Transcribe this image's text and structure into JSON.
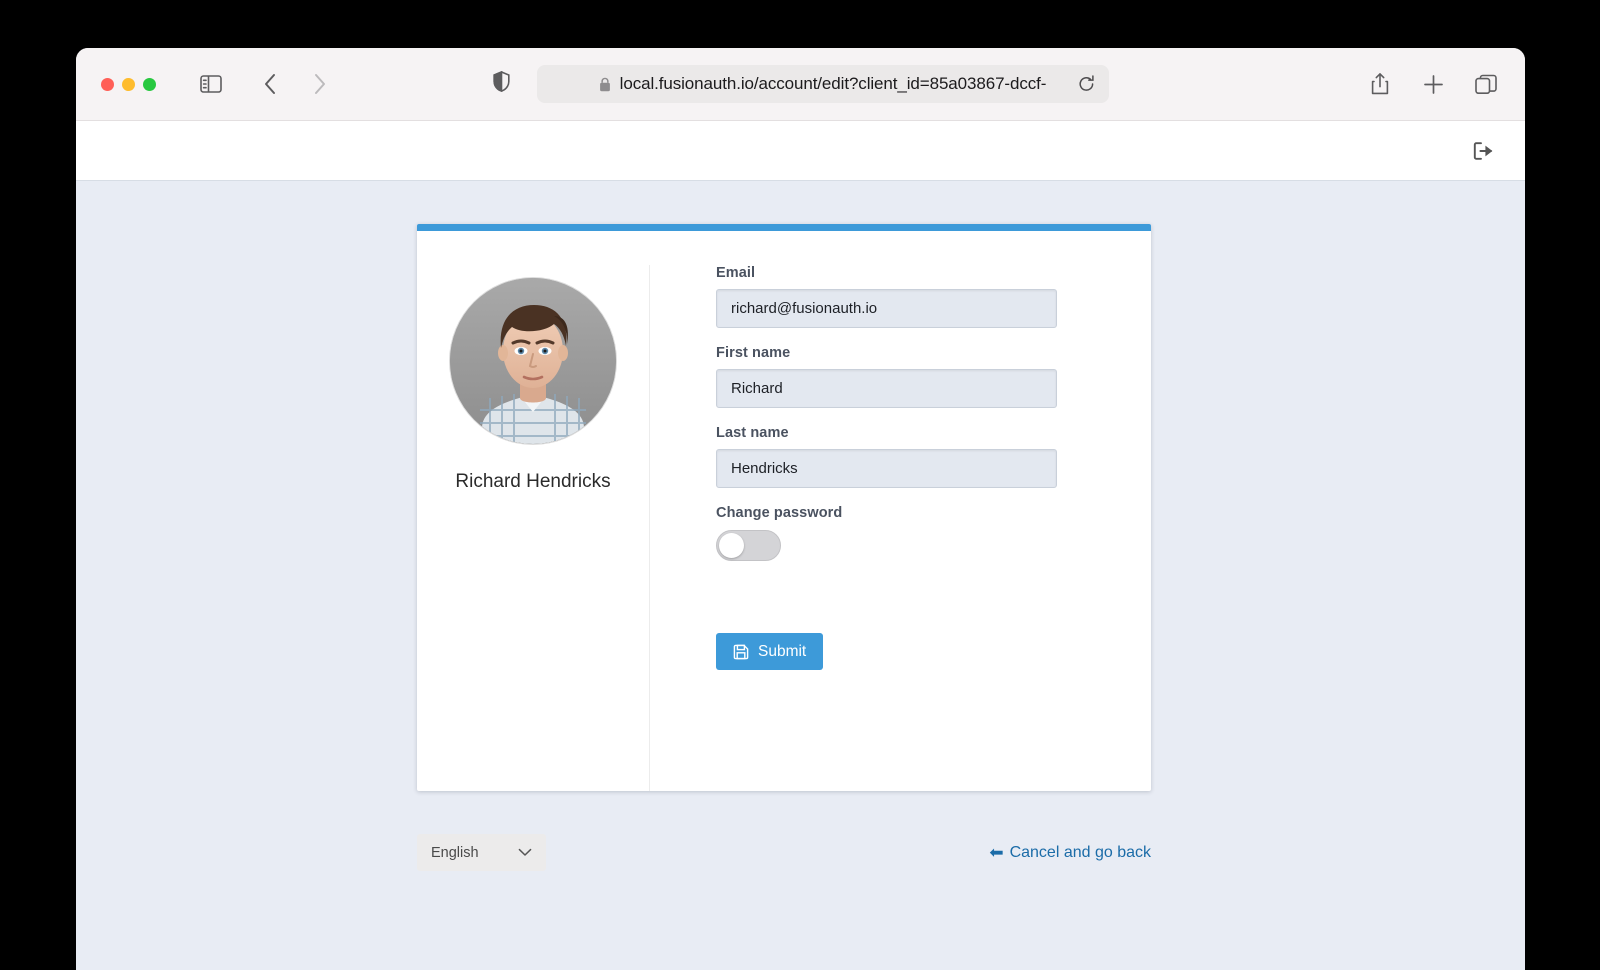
{
  "browser": {
    "traffic_lights": [
      "close",
      "minimize",
      "maximize"
    ],
    "url": "local.fusionauth.io/account/edit?client_id=85a03867-dccf-",
    "icons": {
      "sidebar": "sidebar-toggle-icon",
      "back": "back-chevron-icon",
      "forward": "forward-chevron-icon",
      "shield": "shield-icon",
      "lock": "lock-icon",
      "reload": "reload-icon",
      "share": "share-icon",
      "new_tab": "plus-icon",
      "tabs": "tab-overview-icon"
    }
  },
  "page_header": {
    "logout_icon": "logout-icon"
  },
  "profile": {
    "display_name": "Richard Hendricks",
    "avatar_alt": "Richard Hendricks profile photo"
  },
  "form": {
    "fields": [
      {
        "label": "Email",
        "value": "richard@fusionauth.io",
        "name": "email"
      },
      {
        "label": "First name",
        "value": "Richard",
        "name": "first-name"
      },
      {
        "label": "Last name",
        "value": "Hendricks",
        "name": "last-name"
      }
    ],
    "change_password": {
      "label": "Change password",
      "enabled": false
    },
    "submit_label": "Submit",
    "submit_icon": "save-floppy-icon"
  },
  "footer": {
    "language": "English",
    "language_options": [
      "English"
    ],
    "cancel_label": "Cancel and go back"
  },
  "colors": {
    "accent": "#3d9ad9",
    "link": "#1b6ca8",
    "page_bg": "#e8ecf4",
    "input_bg": "#e3e8f0"
  }
}
